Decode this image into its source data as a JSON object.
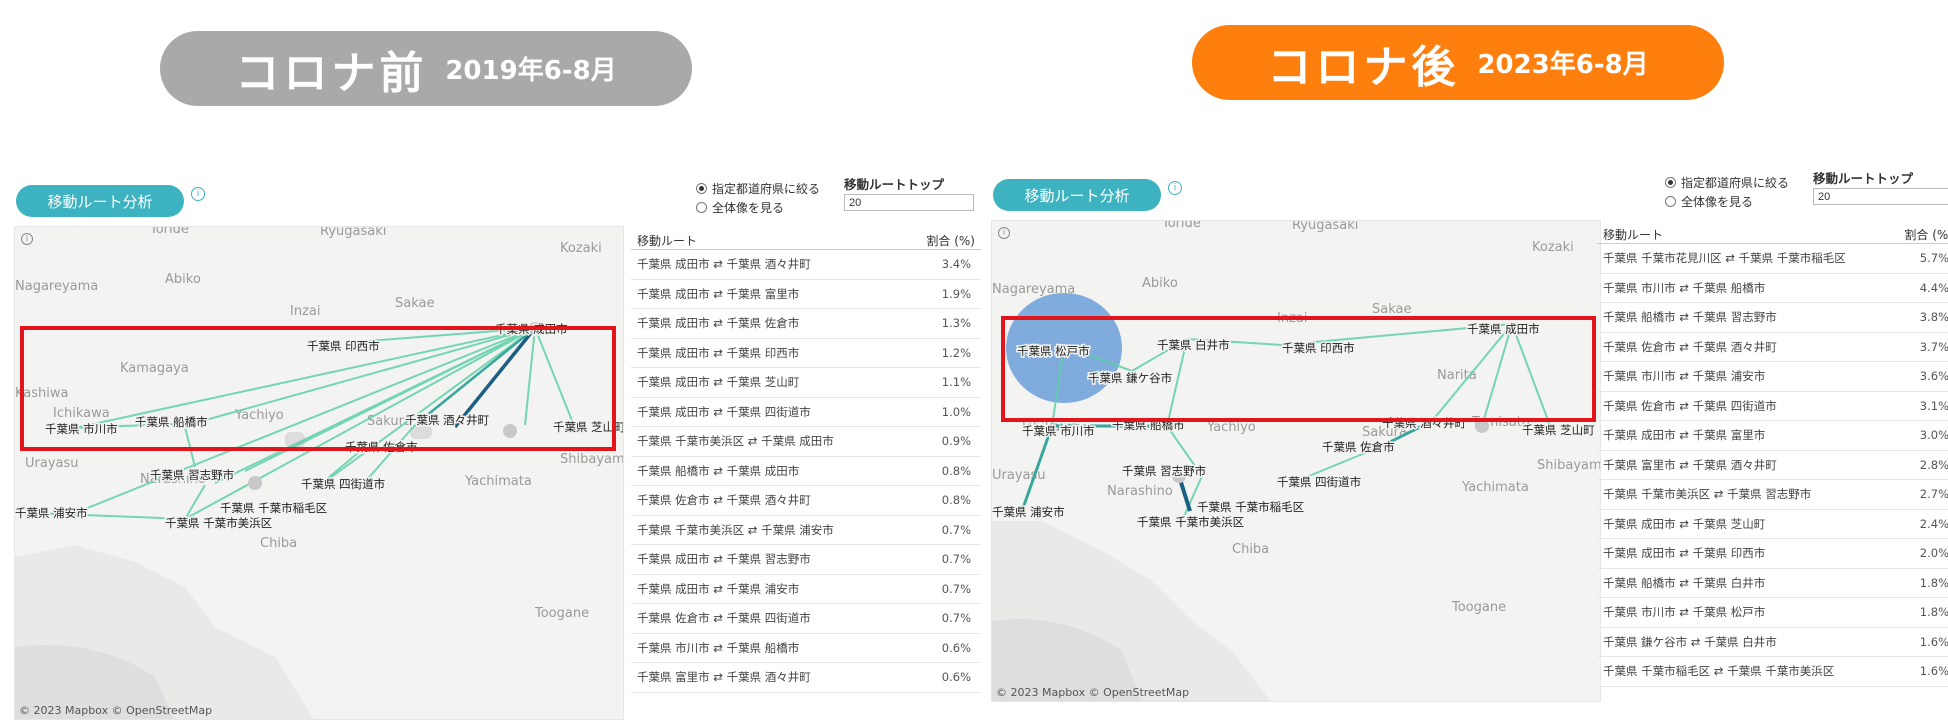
{
  "headers": {
    "before": {
      "title": "コロナ前",
      "period": "2019年6-8月",
      "color": "#a9a9a9"
    },
    "after": {
      "title": "コロナ後",
      "period": "2023年6-8月",
      "color": "#ff7f0e"
    }
  },
  "panel_common": {
    "tab_label": "移動ルート分析",
    "radio_1": "指定都道府県に絞る",
    "radio_2": "全体像を見る",
    "topn_label": "移動ルートトップ",
    "topn_value": "20",
    "col_route": "移動ルート",
    "col_pct": "割合 (%)",
    "copyright": "© 2023 Mapbox  © OpenStreetMap"
  },
  "map_places": [
    "Toride",
    "Ryugasaki",
    "Kozaki",
    "Abiko",
    "Nagareyama",
    "Inzai",
    "Sakae",
    "Kamagaya",
    "Kashiwa",
    "Ichikawa",
    "Yachiyo",
    "Sakura",
    "Narashino",
    "Urayasu",
    "Chiba",
    "Yachimata",
    "Shibayama",
    "Narita",
    "Tomisato",
    "Toogane",
    "Sakura"
  ],
  "left": {
    "rows": [
      {
        "route": "千葉県 成田市 ⇄ 千葉県 酒々井町",
        "pct": "3.4%"
      },
      {
        "route": "千葉県 成田市 ⇄ 千葉県 富里市",
        "pct": "1.9%"
      },
      {
        "route": "千葉県 成田市 ⇄ 千葉県 佐倉市",
        "pct": "1.3%"
      },
      {
        "route": "千葉県 成田市 ⇄ 千葉県 印西市",
        "pct": "1.2%"
      },
      {
        "route": "千葉県 成田市 ⇄ 千葉県 芝山町",
        "pct": "1.1%"
      },
      {
        "route": "千葉県 成田市 ⇄ 千葉県 四街道市",
        "pct": "1.0%"
      },
      {
        "route": "千葉県 千葉市美浜区 ⇄ 千葉県 成田市",
        "pct": "0.9%"
      },
      {
        "route": "千葉県 船橋市 ⇄ 千葉県 成田市",
        "pct": "0.8%"
      },
      {
        "route": "千葉県 佐倉市 ⇄ 千葉県 酒々井町",
        "pct": "0.8%"
      },
      {
        "route": "千葉県 千葉市美浜区 ⇄ 千葉県 浦安市",
        "pct": "0.7%"
      },
      {
        "route": "千葉県 成田市 ⇄ 千葉県 習志野市",
        "pct": "0.7%"
      },
      {
        "route": "千葉県 成田市 ⇄ 千葉県 浦安市",
        "pct": "0.7%"
      },
      {
        "route": "千葉県 佐倉市 ⇄ 千葉県 四街道市",
        "pct": "0.7%"
      },
      {
        "route": "千葉県 市川市 ⇄ 千葉県 船橋市",
        "pct": "0.6%"
      },
      {
        "route": "千葉県 富里市 ⇄ 千葉県 酒々井町",
        "pct": "0.6%"
      }
    ],
    "nodes": {
      "narita": "千葉県 成田市",
      "inzai": "千葉県 印西市",
      "funabashi": "千葉県 船橋市",
      "ichikawa": "千葉県 市川市",
      "shisui": "千葉県 酒々井町",
      "shibayama": "千葉県 芝山町",
      "sakura": "千葉県 佐倉市",
      "narashino": "千葉県 習志野市",
      "yotsukaido": "千葉県 四街道市",
      "inage": "千葉県 千葉市稲毛区",
      "urayasu": "千葉県 浦安市",
      "mihama": "千葉県 千葉市美浜区"
    }
  },
  "right": {
    "rows": [
      {
        "route": "千葉県 千葉市花見川区 ⇄ 千葉県 千葉市稲毛区",
        "pct": "5.7%"
      },
      {
        "route": "千葉県 市川市 ⇄ 千葉県 船橋市",
        "pct": "4.4%"
      },
      {
        "route": "千葉県 船橋市 ⇄ 千葉県 習志野市",
        "pct": "3.8%"
      },
      {
        "route": "千葉県 佐倉市 ⇄ 千葉県 酒々井町",
        "pct": "3.7%"
      },
      {
        "route": "千葉県 市川市 ⇄ 千葉県 浦安市",
        "pct": "3.6%"
      },
      {
        "route": "千葉県 佐倉市 ⇄ 千葉県 四街道市",
        "pct": "3.1%"
      },
      {
        "route": "千葉県 成田市 ⇄ 千葉県 富里市",
        "pct": "3.0%"
      },
      {
        "route": "千葉県 富里市 ⇄ 千葉県 酒々井町",
        "pct": "2.8%"
      },
      {
        "route": "千葉県 千葉市美浜区 ⇄ 千葉県 習志野市",
        "pct": "2.7%"
      },
      {
        "route": "千葉県 成田市 ⇄ 千葉県 芝山町",
        "pct": "2.4%"
      },
      {
        "route": "千葉県 成田市 ⇄ 千葉県 印西市",
        "pct": "2.0%"
      },
      {
        "route": "千葉県 船橋市 ⇄ 千葉県 白井市",
        "pct": "1.8%"
      },
      {
        "route": "千葉県 市川市 ⇄ 千葉県 松戸市",
        "pct": "1.8%"
      },
      {
        "route": "千葉県 鎌ケ谷市 ⇄ 千葉県 白井市",
        "pct": "1.6%"
      },
      {
        "route": "千葉県 千葉市稲毛区 ⇄ 千葉県 千葉市美浜区",
        "pct": "1.6%"
      }
    ],
    "nodes": {
      "matsudo": "千葉県 松戸市",
      "kamagaya": "千葉県 鎌ケ谷市",
      "shiroi": "千葉県 白井市",
      "inzai": "千葉県 印西市",
      "narita": "千葉県 成田市",
      "ichikawa": "千葉県 市川市",
      "funabashi": "千葉県 船橋市",
      "shisui": "千葉県 酒々井町",
      "shibayama": "千葉県 芝山町",
      "sakura": "千葉県 佐倉市",
      "narashino": "千葉県 習志野市",
      "yotsukaido": "千葉県 四街道市",
      "inage": "千葉県 千葉市稲毛区",
      "urayasu": "千葉県 浦安市",
      "mihama": "千葉県 千葉市美浜区"
    }
  }
}
